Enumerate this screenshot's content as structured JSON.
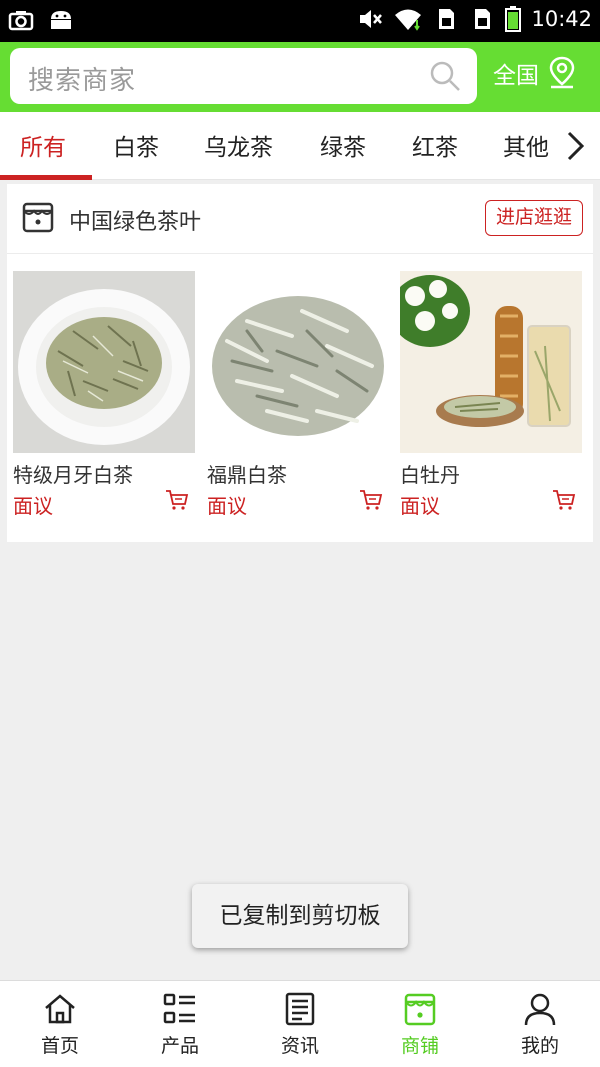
{
  "status_bar": {
    "time": "10:42",
    "icons": [
      "camera-icon",
      "android-icon",
      "mute-icon",
      "wifi-icon",
      "sim1-icon",
      "sim2-icon",
      "battery-icon"
    ]
  },
  "header": {
    "search_placeholder": "搜索商家",
    "region_label": "全国",
    "accent_color": "#66dd33"
  },
  "tabs": {
    "items": [
      {
        "label": "所有",
        "active": true
      },
      {
        "label": "白茶"
      },
      {
        "label": "乌龙茶"
      },
      {
        "label": "绿茶"
      },
      {
        "label": "红茶"
      },
      {
        "label": "其他"
      }
    ],
    "active_color": "#cc2222"
  },
  "shop": {
    "name": "中国绿色茶叶",
    "enter_label": "进店逛逛",
    "products": [
      {
        "name": "特级月牙白茶",
        "price": "面议"
      },
      {
        "name": "福鼎白茶",
        "price": "面议"
      },
      {
        "name": "白牡丹",
        "price": "面议"
      }
    ]
  },
  "toast": {
    "text": "已复制到剪切板"
  },
  "bottom_nav": {
    "items": [
      {
        "label": "首页",
        "icon": "home-icon"
      },
      {
        "label": "产品",
        "icon": "product-list-icon"
      },
      {
        "label": "资讯",
        "icon": "news-icon"
      },
      {
        "label": "商铺",
        "icon": "shop-icon",
        "active": true
      },
      {
        "label": "我的",
        "icon": "user-icon"
      }
    ],
    "active_color": "#55cc22"
  }
}
